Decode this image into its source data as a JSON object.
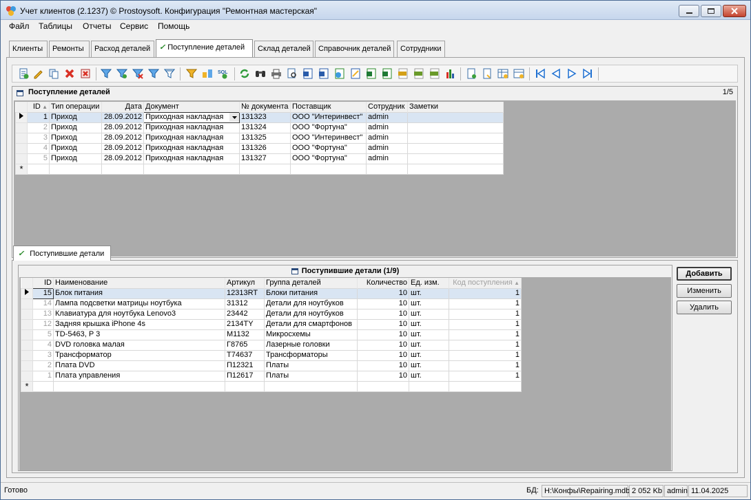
{
  "window": {
    "title": "Учет клиентов (2.1237) © Prostoysoft. Конфигурация \"Ремонтная мастерская\""
  },
  "menu": [
    "Файл",
    "Таблицы",
    "Отчеты",
    "Сервис",
    "Помощь"
  ],
  "tabs": [
    "Клиенты",
    "Ремонты",
    "Расход деталей",
    "Поступление деталей",
    "Склад деталей",
    "Справочник деталей",
    "Сотрудники"
  ],
  "toolbar_icons": [
    "add-record-icon",
    "edit-icon",
    "copy-icon",
    "delete-icon",
    "delete-all-icon",
    "filter-icon",
    "filter-by-value-icon",
    "filter-remove-icon",
    "filter-clear-icon",
    "filter-advanced-icon",
    "sort-filter-icon",
    "group-icon",
    "sql-icon",
    "refresh-icon",
    "find-icon",
    "print-icon",
    "print-preview-icon",
    "export-word-icon",
    "export-doc-icon",
    "export-html-icon",
    "export-rtf-icon",
    "export-excel-icon",
    "export-xls-icon",
    "export-txt-icon",
    "export-csv-icon",
    "export-xml-icon",
    "chart-icon",
    "notes-icon",
    "report-icon",
    "table-settings-icon",
    "form-settings-icon",
    "first-record-icon",
    "prev-record-icon",
    "next-record-icon",
    "last-record-icon"
  ],
  "top_panel": {
    "title": "Поступление деталей",
    "counter": "1/5",
    "columns": [
      "ID",
      "Тип операции",
      "Дата",
      "Документ",
      "№ документа",
      "Поставщик",
      "Сотрудник",
      "Заметки"
    ],
    "rows": [
      [
        "1",
        "Приход",
        "28.09.2012",
        "Приходная накладная",
        "131323",
        "ООО \"Интеринвест\"",
        "admin",
        ""
      ],
      [
        "2",
        "Приход",
        "28.09.2012",
        "Приходная накладная",
        "131324",
        "ООО \"Фортуна\"",
        "admin",
        ""
      ],
      [
        "3",
        "Приход",
        "28.09.2012",
        "Приходная накладная",
        "131325",
        "ООО \"Интеринвест\"",
        "admin",
        ""
      ],
      [
        "4",
        "Приход",
        "28.09.2012",
        "Приходная накладная",
        "131326",
        "ООО \"Фортуна\"",
        "admin",
        ""
      ],
      [
        "5",
        "Приход",
        "28.09.2012",
        "Приходная накладная",
        "131327",
        "ООО \"Фортуна\"",
        "admin",
        ""
      ]
    ]
  },
  "sub_tab": "Поступившие детали",
  "bottom_panel": {
    "title": "Поступившие детали (1/9)",
    "columns": [
      "ID",
      "Наименование",
      "Артикул",
      "Группа деталей",
      "Количество",
      "Ед. изм.",
      "Код поступления"
    ],
    "rows": [
      [
        "15",
        "Блок питания",
        "12313RT",
        "Блоки питания",
        "10",
        "шт.",
        "1"
      ],
      [
        "14",
        "Лампа подсветки матрицы ноутбука",
        "31312",
        "Детали для ноутбуков",
        "10",
        "шт.",
        "1"
      ],
      [
        "13",
        "Клавиатура для ноутбука Lenovo3",
        "23442",
        "Детали для ноутбуков",
        "10",
        "шт.",
        "1"
      ],
      [
        "12",
        "Задняя крышка iPhone 4s",
        "2134TY",
        "Детали для смартфонов",
        "10",
        "шт.",
        "1"
      ],
      [
        "5",
        "TD-5463, P 3",
        "M1132",
        "Микросхемы",
        "10",
        "шт.",
        "1"
      ],
      [
        "4",
        "DVD головка малая",
        "Г8765",
        "Лазерные головки",
        "10",
        "шт.",
        "1"
      ],
      [
        "3",
        "Трансформатор",
        "T74637",
        "Трансформаторы",
        "10",
        "шт.",
        "1"
      ],
      [
        "2",
        "Плата DVD",
        "П12321",
        "Платы",
        "10",
        "шт.",
        "1"
      ],
      [
        "1",
        "Плата управления",
        "П12617",
        "Платы",
        "10",
        "шт.",
        "1"
      ]
    ],
    "buttons": {
      "add": "Добавить",
      "edit": "Изменить",
      "delete": "Удалить"
    }
  },
  "status": {
    "state": "Готово",
    "db_label": "БД:",
    "db_path": "H:\\Конфы\\Repairing.mdb",
    "size": "2 052 Kb",
    "user": "admin",
    "date": "11.04.2025"
  }
}
